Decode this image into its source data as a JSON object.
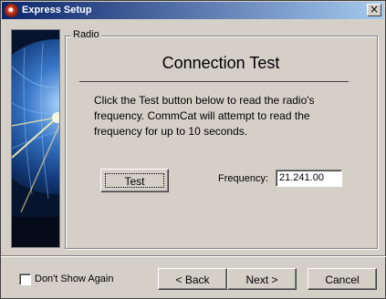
{
  "window": {
    "title": "Express Setup",
    "close_glyph": "×"
  },
  "group": {
    "label": "Radio"
  },
  "heading": "Connection Test",
  "description": "Click the Test button below to read the radio's frequency. CommCat will attempt to read the frequency for up to 10 seconds.",
  "test_button": "Test",
  "frequency": {
    "label": "Frequency:",
    "value": "21.241.00"
  },
  "footer": {
    "checkbox_label": "Don't Show Again",
    "checkbox_checked": false,
    "back_label": "< Back",
    "next_label": "Next >",
    "cancel_label": "Cancel"
  },
  "icons": {
    "app": "app-icon",
    "close": "close-icon",
    "side": "globe-image"
  },
  "colors": {
    "title_bar_start": "#0a246a",
    "title_bar_end": "#a6caf0",
    "dialog_bg": "#d4d0c8"
  }
}
